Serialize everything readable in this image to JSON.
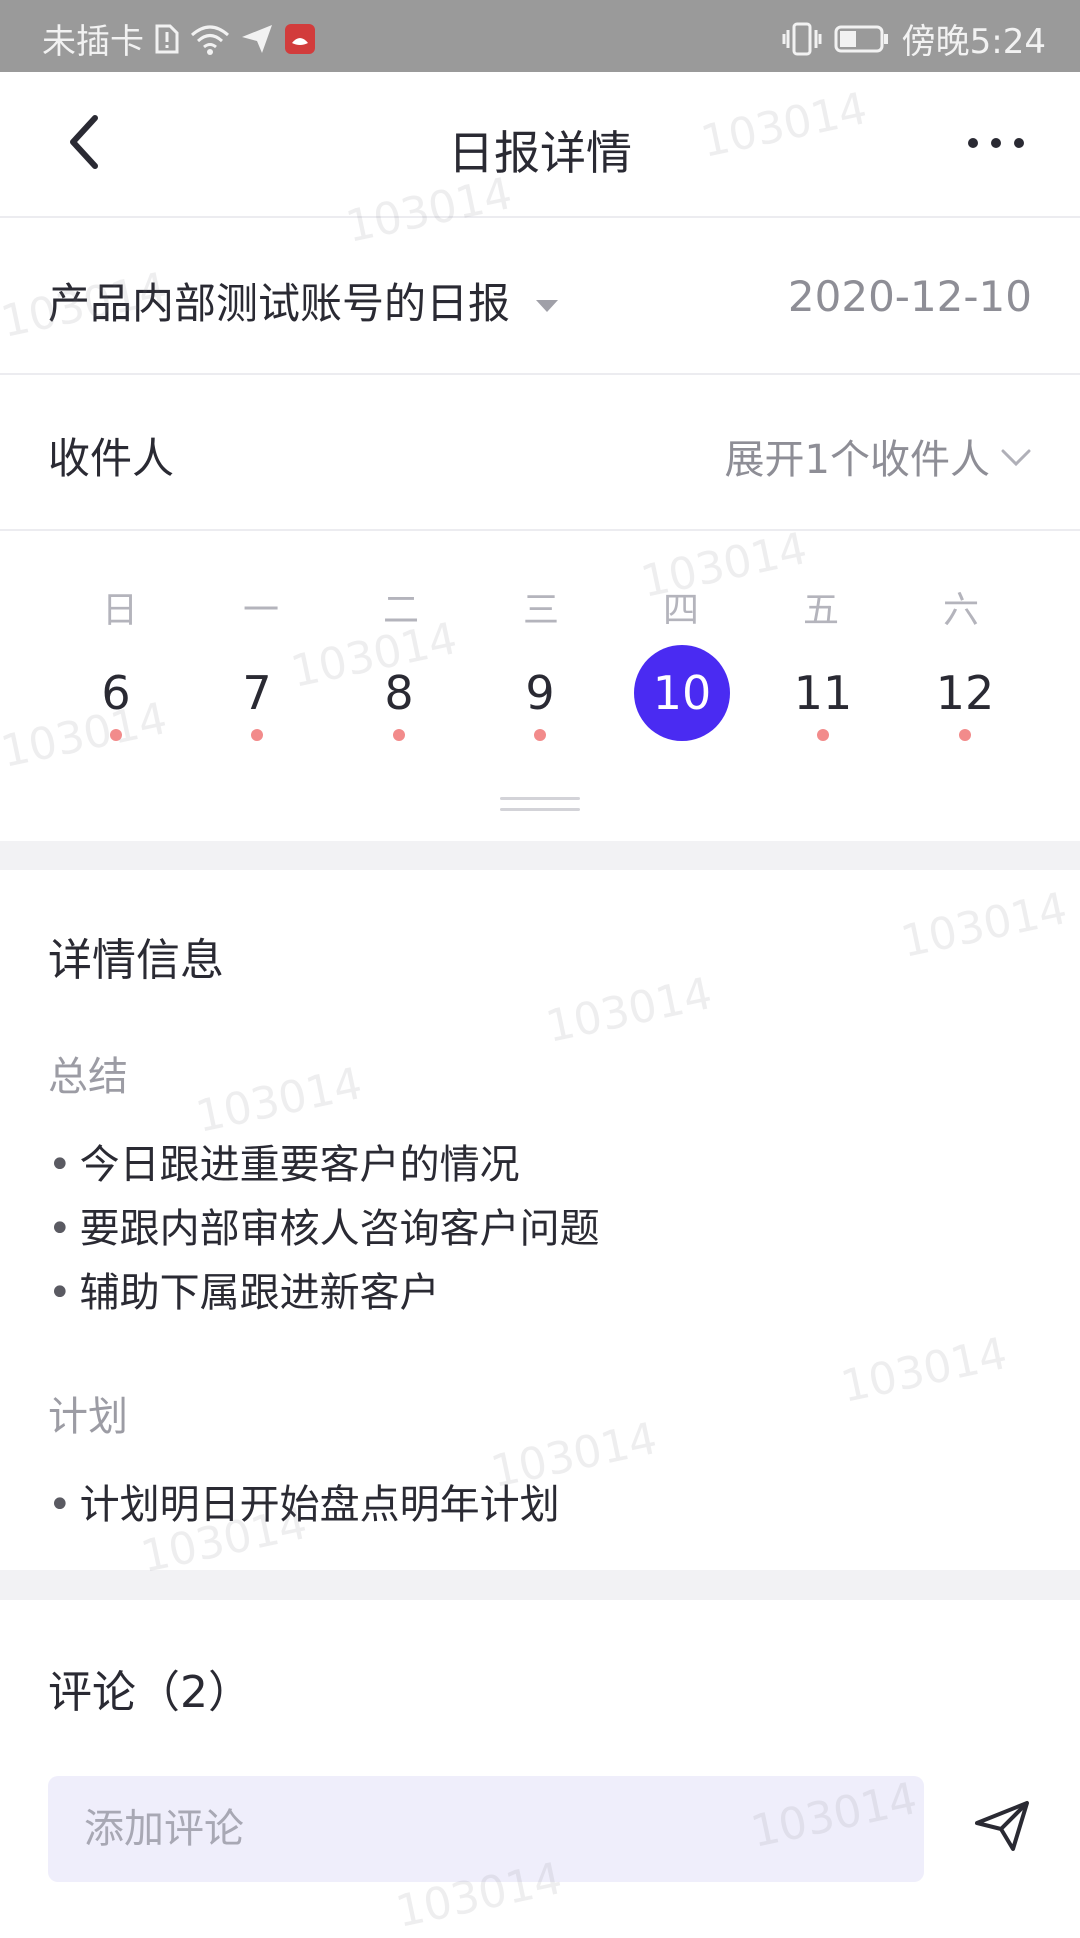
{
  "status_bar": {
    "carrier": "未插卡",
    "time": "傍晚5:24",
    "icons": [
      "sim-error-icon",
      "wifi-icon",
      "send-location-icon",
      "app-notification-icon",
      "vibrate-icon",
      "battery-icon"
    ]
  },
  "nav": {
    "title": "日报详情",
    "back_icon": "chevron-left-icon",
    "more_icon": "more-horizontal-icon"
  },
  "report": {
    "title": "产品内部测试账号的日报",
    "date": "2020-12-10"
  },
  "recipients": {
    "label": "收件人",
    "expand": "展开1个收件人"
  },
  "calendar": {
    "weekdays": [
      "日",
      "一",
      "二",
      "三",
      "四",
      "五",
      "六"
    ],
    "days": [
      "6",
      "7",
      "8",
      "9",
      "10",
      "11",
      "12"
    ],
    "selected_day": "10",
    "accent_color": "#4a2bf2",
    "dot_color": "#f28b8b"
  },
  "details": {
    "title": "详情信息",
    "summary_label": "总结",
    "summary_items": [
      "今日跟进重要客户的情况",
      "要跟内部审核人咨询客户问题",
      "辅助下属跟进新客户"
    ],
    "plan_label": "计划",
    "plan_items": [
      "计划明日开始盘点明年计划"
    ]
  },
  "comments": {
    "title": "评论（2）",
    "placeholder": "添加评论"
  },
  "watermark": "103014"
}
